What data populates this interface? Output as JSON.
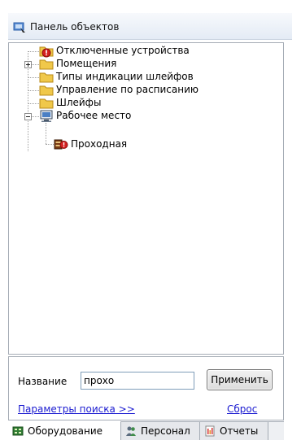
{
  "title": "Панель объектов",
  "tree": {
    "items": [
      {
        "label": "Отключенные устройства",
        "icon": "folder-alert-icon"
      },
      {
        "label": "Помещения",
        "icon": "folder-icon"
      },
      {
        "label": "Типы индикации шлейфов",
        "icon": "folder-icon"
      },
      {
        "label": "Управление по расписанию",
        "icon": "folder-icon"
      },
      {
        "label": "Шлейфы",
        "icon": "folder-icon"
      },
      {
        "label": "Рабочее место",
        "icon": "workstation-icon"
      },
      {
        "label": "Проходная",
        "icon": "access-point-alert-icon"
      }
    ]
  },
  "search": {
    "label": "Название",
    "value": "прохо",
    "apply_label": "Применить",
    "params_link": "Параметры поиска >>",
    "reset_link": "Сброс"
  },
  "tabs": [
    {
      "label": "Оборудование",
      "icon": "equipment-icon",
      "active": true
    },
    {
      "label": "Персонал",
      "icon": "people-icon",
      "active": false
    },
    {
      "label": "Отчеты",
      "icon": "report-icon",
      "active": false
    }
  ],
  "colors": {
    "link": "#1a1ad0",
    "folder": "#f0c84a",
    "alert": "#d42020"
  }
}
